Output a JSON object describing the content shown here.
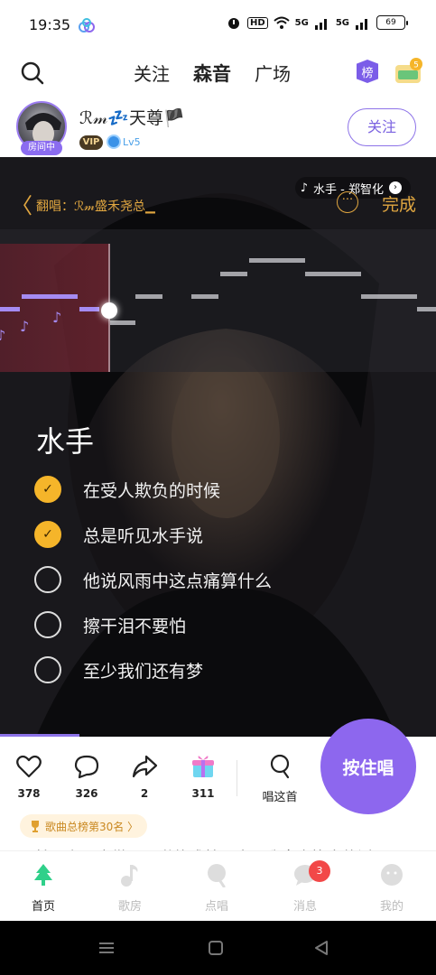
{
  "status_bar": {
    "time": "19:35",
    "network_1": "5G",
    "network_2": "5G",
    "battery": "69",
    "hd_label": "HD"
  },
  "top_nav": {
    "tabs": [
      {
        "label": "关注"
      },
      {
        "label": "森音"
      },
      {
        "label": "广场"
      }
    ],
    "active_tab": "森音",
    "rank_badge": "榜",
    "coin_label": "5"
  },
  "user": {
    "name": "ℛ𝓂💤天尊🏴",
    "avatar_tag": "房间中",
    "vip": "VIP",
    "level": "Lv5",
    "follow_label": "关注"
  },
  "stage": {
    "back_glyph": "〈",
    "cover_text": "翻唱：ℛ𝓂盛禾尧总▁",
    "song_info": "水手 - 郑智化",
    "more_glyph": "···",
    "done_label": "完成",
    "song_title": "水手",
    "lyrics": [
      {
        "text": "在受人欺负的时候",
        "done": true
      },
      {
        "text": "总是听见水手说",
        "done": true
      },
      {
        "text": "他说风雨中这点痛算什么",
        "done": false
      },
      {
        "text": "擦干泪不要怕",
        "done": false
      },
      {
        "text": "至少我们还有梦",
        "done": false
      }
    ]
  },
  "actions": {
    "likes": "378",
    "comments": "326",
    "shares": "2",
    "gifts": "311",
    "sing_this": "唱这首",
    "hold_to_sing": "按住唱"
  },
  "rank_chip": "歌曲总榜第30名 〉",
  "comment_preview": "哪怕只有一点微不足道的成就，也是我拿命换来的活",
  "bottom_nav": {
    "items": [
      {
        "label": "首页"
      },
      {
        "label": "歌房"
      },
      {
        "label": "点唱"
      },
      {
        "label": "消息"
      },
      {
        "label": "我的"
      }
    ],
    "message_badge": "3"
  },
  "colors": {
    "accent": "#8d67ee",
    "gold": "#e0a640",
    "check": "#f5b52a",
    "active_green": "#3fe0a6"
  }
}
